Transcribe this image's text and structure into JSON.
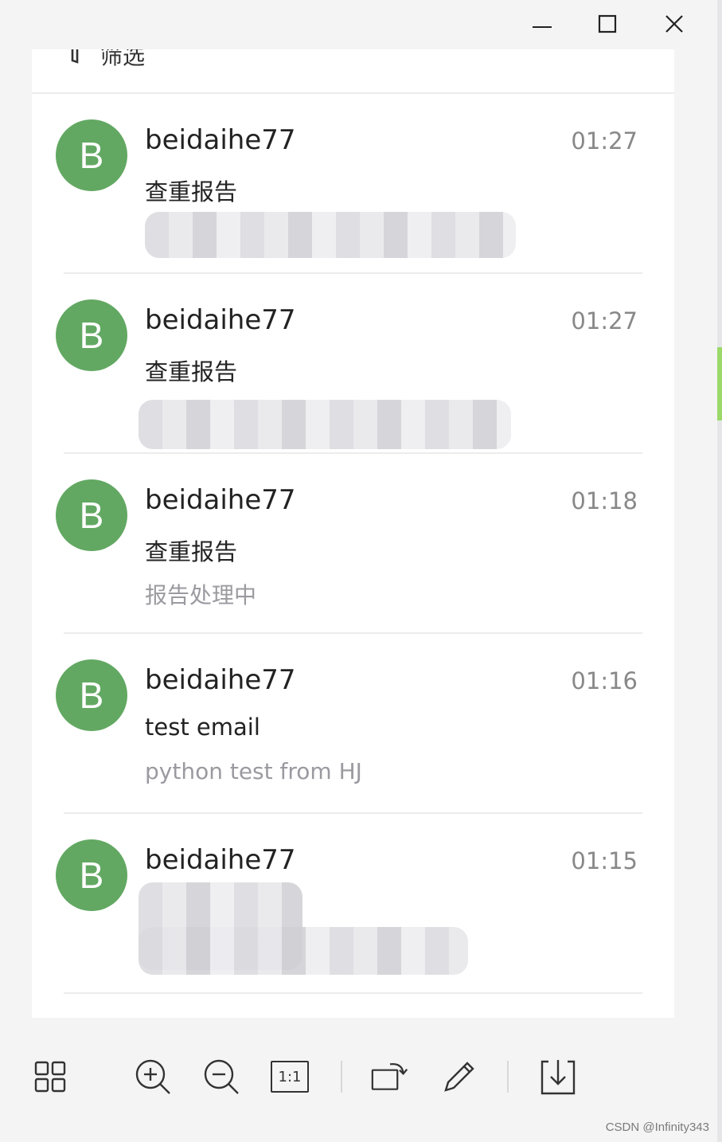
{
  "window": {
    "controls": {
      "minimize": "minimize-icon",
      "maximize": "maximize-icon",
      "close": "close-icon"
    }
  },
  "filter": {
    "label": "筛选"
  },
  "mails": [
    {
      "avatar": "B",
      "sender": "beidaihe77",
      "time": "01:27",
      "subject": "查重报告",
      "preview": ""
    },
    {
      "avatar": "B",
      "sender": "beidaihe77",
      "time": "01:27",
      "subject": "查重报告",
      "preview": ""
    },
    {
      "avatar": "B",
      "sender": "beidaihe77",
      "time": "01:18",
      "subject": "查重报告",
      "preview": "报告处理中"
    },
    {
      "avatar": "B",
      "sender": "beidaihe77",
      "time": "01:16",
      "subject": "test email",
      "preview": "python test from HJ"
    },
    {
      "avatar": "B",
      "sender": "beidaihe77",
      "time": "01:15",
      "subject": "",
      "preview": ""
    }
  ],
  "toolbar": {
    "items": [
      "grid-icon",
      "zoom-in-icon",
      "zoom-out-icon",
      "actual-size-icon",
      "rotate-icon",
      "edit-icon",
      "download-icon"
    ],
    "actual_size_label": "1:1"
  },
  "watermark": "CSDN @Infinity343",
  "colors": {
    "avatar": "#62a862",
    "accent_edge": "#9ad96a"
  }
}
